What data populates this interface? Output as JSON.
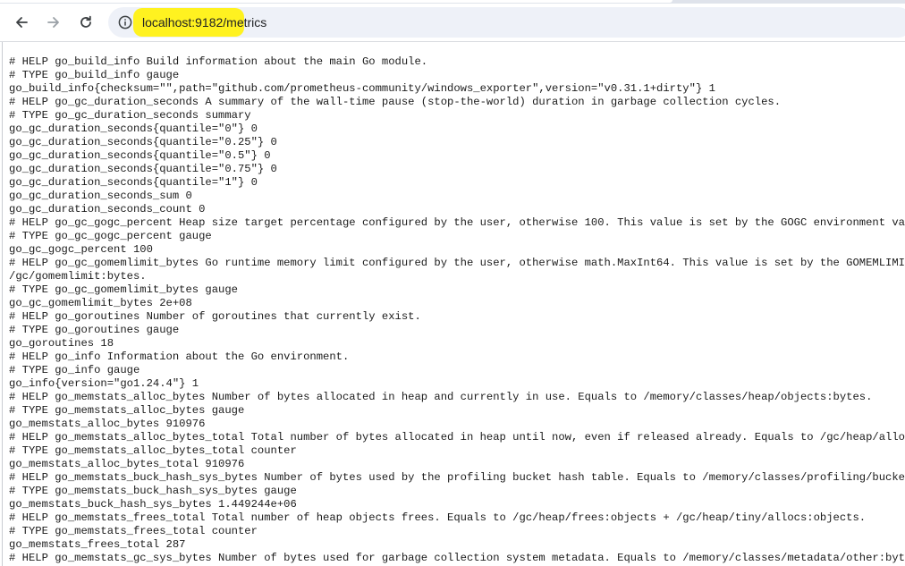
{
  "browser": {
    "url": "localhost:9182/metrics",
    "icons": {
      "back": "arrow-left-icon",
      "forward": "arrow-right-icon",
      "reload": "reload-icon",
      "site_info": "info-circle-icon"
    },
    "colors": {
      "url_highlight": "#fff220",
      "omnibox": "#eef1f8"
    }
  },
  "content": {
    "lines": [
      "# HELP go_build_info Build information about the main Go module.",
      "# TYPE go_build_info gauge",
      "go_build_info{checksum=\"\",path=\"github.com/prometheus-community/windows_exporter\",version=\"v0.31.1+dirty\"} 1",
      "# HELP go_gc_duration_seconds A summary of the wall-time pause (stop-the-world) duration in garbage collection cycles.",
      "# TYPE go_gc_duration_seconds summary",
      "go_gc_duration_seconds{quantile=\"0\"} 0",
      "go_gc_duration_seconds{quantile=\"0.25\"} 0",
      "go_gc_duration_seconds{quantile=\"0.5\"} 0",
      "go_gc_duration_seconds{quantile=\"0.75\"} 0",
      "go_gc_duration_seconds{quantile=\"1\"} 0",
      "go_gc_duration_seconds_sum 0",
      "go_gc_duration_seconds_count 0",
      "# HELP go_gc_gogc_percent Heap size target percentage configured by the user, otherwise 100. This value is set by the GOGC environment varia",
      "# TYPE go_gc_gogc_percent gauge",
      "go_gc_gogc_percent 100",
      "# HELP go_gc_gomemlimit_bytes Go runtime memory limit configured by the user, otherwise math.MaxInt64. This value is set by the GOMEMLIMIT e",
      "/gc/gomemlimit:bytes.",
      "# TYPE go_gc_gomemlimit_bytes gauge",
      "go_gc_gomemlimit_bytes 2e+08",
      "# HELP go_goroutines Number of goroutines that currently exist.",
      "# TYPE go_goroutines gauge",
      "go_goroutines 18",
      "# HELP go_info Information about the Go environment.",
      "# TYPE go_info gauge",
      "go_info{version=\"go1.24.4\"} 1",
      "# HELP go_memstats_alloc_bytes Number of bytes allocated in heap and currently in use. Equals to /memory/classes/heap/objects:bytes.",
      "# TYPE go_memstats_alloc_bytes gauge",
      "go_memstats_alloc_bytes 910976",
      "# HELP go_memstats_alloc_bytes_total Total number of bytes allocated in heap until now, even if released already. Equals to /gc/heap/allocs:b",
      "# TYPE go_memstats_alloc_bytes_total counter",
      "go_memstats_alloc_bytes_total 910976",
      "# HELP go_memstats_buck_hash_sys_bytes Number of bytes used by the profiling bucket hash table. Equals to /memory/classes/profiling/buckets:b",
      "# TYPE go_memstats_buck_hash_sys_bytes gauge",
      "go_memstats_buck_hash_sys_bytes 1.449244e+06",
      "# HELP go_memstats_frees_total Total number of heap objects frees. Equals to /gc/heap/frees:objects + /gc/heap/tiny/allocs:objects.",
      "# TYPE go_memstats_frees_total counter",
      "go_memstats_frees_total 287",
      "# HELP go_memstats_gc_sys_bytes Number of bytes used for garbage collection system metadata. Equals to /memory/classes/metadata/other:bytes."
    ]
  }
}
